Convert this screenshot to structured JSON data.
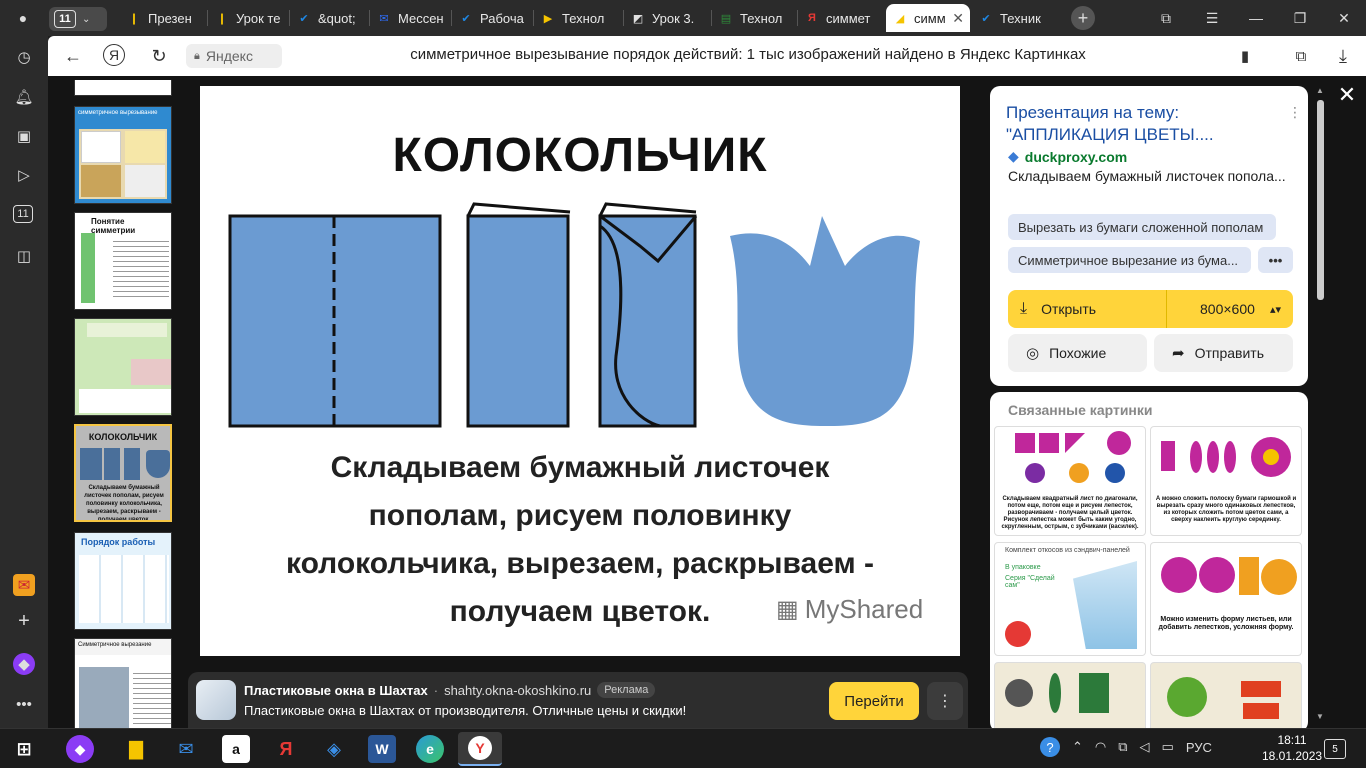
{
  "tabbar": {
    "tab_count": "11",
    "tabs": [
      {
        "label": "Презен",
        "color": "#f5c400",
        "glyph": "❙"
      },
      {
        "label": "Урок те",
        "color": "#f5c400",
        "glyph": "❙"
      },
      {
        "label": "&quot;",
        "color": "#1e88e5",
        "glyph": "✔"
      },
      {
        "label": "Мессен",
        "color": "#2f6df6",
        "glyph": "✉"
      },
      {
        "label": "Рабоча",
        "color": "#1e88e5",
        "glyph": "✔"
      },
      {
        "label": "Технол",
        "color": "#f5c400",
        "glyph": "▶"
      },
      {
        "label": "Урок 3.",
        "color": "#e0e0e0",
        "glyph": "◩"
      },
      {
        "label": "Технол",
        "color": "#2e8b3a",
        "glyph": "▤"
      },
      {
        "label": "симмет",
        "color": "#e53935",
        "glyph": "Я"
      },
      {
        "label": "симм",
        "color": "#f5c400",
        "glyph": "◢"
      },
      {
        "label": "Техник",
        "color": "#1e88e5",
        "glyph": "✔"
      }
    ]
  },
  "address": {
    "site": "Яндекс",
    "title": "симметричное вырезывание порядок действий: 1 тыс изображений найдено в Яндекс Картинках"
  },
  "main_image": {
    "heading": "КОЛОКОЛЬЧИК",
    "caption_lines": [
      "Складываем бумажный листочек",
      "пополам, рисуем половинку",
      "колокольчика, вырезаем, раскрываем -",
      "получаем цветок."
    ],
    "watermark": "MyShared",
    "fill_color": "#6b9bd2"
  },
  "thumbnails": [
    {
      "title": "симметричное вырезывание"
    },
    {
      "title": "Понятие симметрии"
    },
    {
      "title": ""
    },
    {
      "title": "КОЛОКОЛЬЧИК",
      "caption": "Складываем бумажный листочек пополам, рисуем половинку колокольчика, вырезаем, раскрываем - получаем цветок."
    },
    {
      "title": "Порядок работы"
    },
    {
      "title": "Симметричное вырезание"
    }
  ],
  "panel": {
    "title": "Презентация на тему: \"АППЛИКАЦИЯ ЦВЕТЫ....",
    "domain": "duckproxy.com",
    "description": "Складываем бумажный листочек попола...",
    "chips": [
      "Вырезать из бумаги сложенной пополам",
      "Симметричное вырезание из бума...",
      "•••"
    ],
    "open_label": "Открыть",
    "size_label": "800×600",
    "similar_label": "Похожие",
    "share_label": "Отправить",
    "related_title": "Связанные картинки",
    "related": [
      {
        "caption": "Складываем квадратный лист по диагонали, потом еще, потом еще и рисуем лепесток, разворачиваем - получаем целый цветок. Рисунок лепестка может быть каким угодно, скругленным, острым, с зубчиками (василек)."
      },
      {
        "caption": "А можно сложить полоску бумаги гармошкой и вырезать сразу много одинаковых лепестков, из которых сложить потом цветок сами, а сверху наклеить круглую серединку."
      },
      {
        "caption": "Комплект откосов из сэндвич-панелей",
        "sub1": "В упаковке",
        "sub2": "Серия \"Сделай сам\""
      },
      {
        "caption": "Можно изменить форму листьев, или добавить лепестков, усложняя форму."
      },
      {
        "caption": ""
      },
      {
        "caption": ""
      }
    ]
  },
  "ad": {
    "title": "Пластиковые окна в Шахтах",
    "domain": "shahty.okna-okoshkino.ru",
    "badge": "Реклама",
    "text": "Пластиковые окна в Шахтах от производителя. Отличные цены и скидки!",
    "go_label": "Перейти"
  },
  "taskbar": {
    "language": "РУС",
    "time": "18:11",
    "date": "18.01.2023",
    "notifications": "5"
  }
}
